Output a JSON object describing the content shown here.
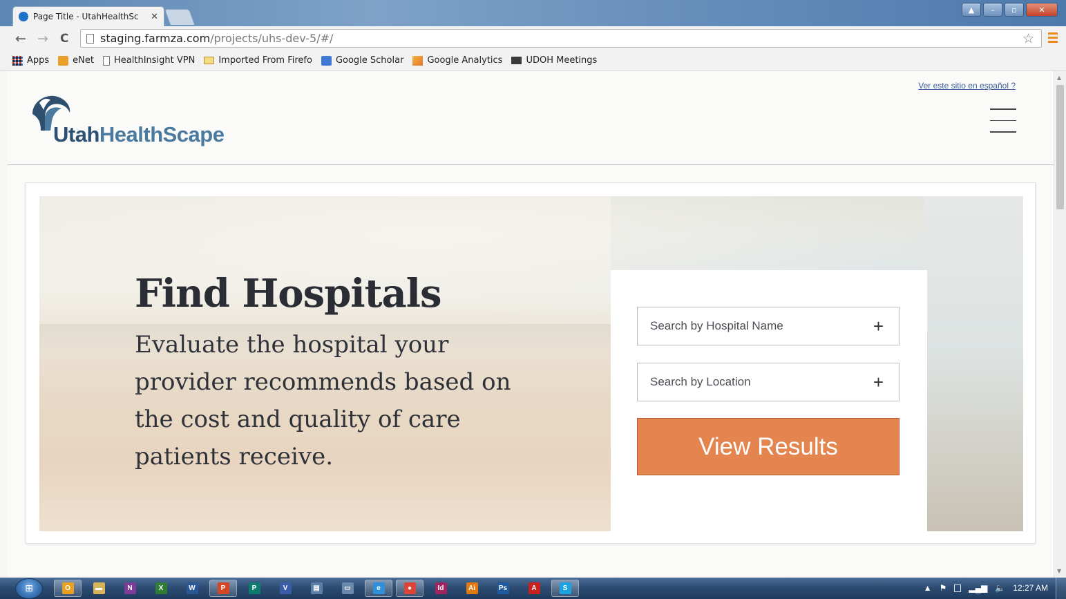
{
  "browser": {
    "tab_title": "Page Title - UtahHealthSc",
    "tab_close": "✕",
    "url_host": "staging.farmza.com",
    "url_path": "/projects/uhs-dev-5/#/",
    "nav": {
      "back": "←",
      "forward": "→",
      "reload": "C"
    },
    "star": "☆",
    "bookmarks": [
      {
        "label": "Apps",
        "icon": "apps-grid-icon",
        "color": "#d4452f"
      },
      {
        "label": "eNet",
        "icon": "enet-icon",
        "color": "#e8a02a"
      },
      {
        "label": "HealthInsight VPN",
        "icon": "page-icon",
        "color": "#ffffff"
      },
      {
        "label": "Imported From Firefo",
        "icon": "folder-icon",
        "color": "#e6c15a"
      },
      {
        "label": "Google Scholar",
        "icon": "scholar-icon",
        "color": "#3f7ad6"
      },
      {
        "label": "Google Analytics",
        "icon": "analytics-icon",
        "color": "#e8742a"
      },
      {
        "label": "UDOH Meetings",
        "icon": "meetings-icon",
        "color": "#3a3a3a"
      }
    ]
  },
  "header": {
    "spanish_link": "Ver este sitio en español ?",
    "logo_utah": "Utah",
    "logo_rest": "HealthScape"
  },
  "hero": {
    "title": "Find Hospitals",
    "subtitle": "Evaluate the hospital your provider recommends based on the cost and quality of care patients receive."
  },
  "search": {
    "hospital_name": "Search by Hospital Name",
    "location": "Search by Location",
    "plus": "+",
    "view_results": "View Results"
  },
  "taskbar": {
    "apps": [
      {
        "name": "outlook",
        "letter": "O",
        "color": "#e8a020",
        "active": true
      },
      {
        "name": "explorer",
        "letter": "▬",
        "color": "#d9b55a",
        "active": false
      },
      {
        "name": "onenote",
        "letter": "N",
        "color": "#7d3c98",
        "active": false
      },
      {
        "name": "excel",
        "letter": "X",
        "color": "#2e7d32",
        "active": false
      },
      {
        "name": "word",
        "letter": "W",
        "color": "#2b5797",
        "active": false
      },
      {
        "name": "powerpoint",
        "letter": "P",
        "color": "#d24726",
        "active": true
      },
      {
        "name": "publisher",
        "letter": "P",
        "color": "#0f7b6c",
        "active": false
      },
      {
        "name": "visio",
        "letter": "V",
        "color": "#3a5ca8",
        "active": false
      },
      {
        "name": "notepad",
        "letter": "▤",
        "color": "#5b7fa8",
        "active": false
      },
      {
        "name": "network",
        "letter": "▭",
        "color": "#6b89ad",
        "active": false
      },
      {
        "name": "internet-explorer",
        "letter": "e",
        "color": "#2f8fd8",
        "active": true
      },
      {
        "name": "chrome",
        "letter": "●",
        "color": "#db4437",
        "active": true
      },
      {
        "name": "indesign",
        "letter": "Id",
        "color": "#a0245e",
        "active": false
      },
      {
        "name": "illustrator",
        "letter": "Ai",
        "color": "#e07a10",
        "active": false
      },
      {
        "name": "photoshop",
        "letter": "Ps",
        "color": "#1e5a9c",
        "active": false
      },
      {
        "name": "acrobat",
        "letter": "A",
        "color": "#c8201c",
        "active": false
      },
      {
        "name": "skype",
        "letter": "S",
        "color": "#1aa3e0",
        "active": true
      }
    ],
    "clock": "12:27 AM"
  }
}
